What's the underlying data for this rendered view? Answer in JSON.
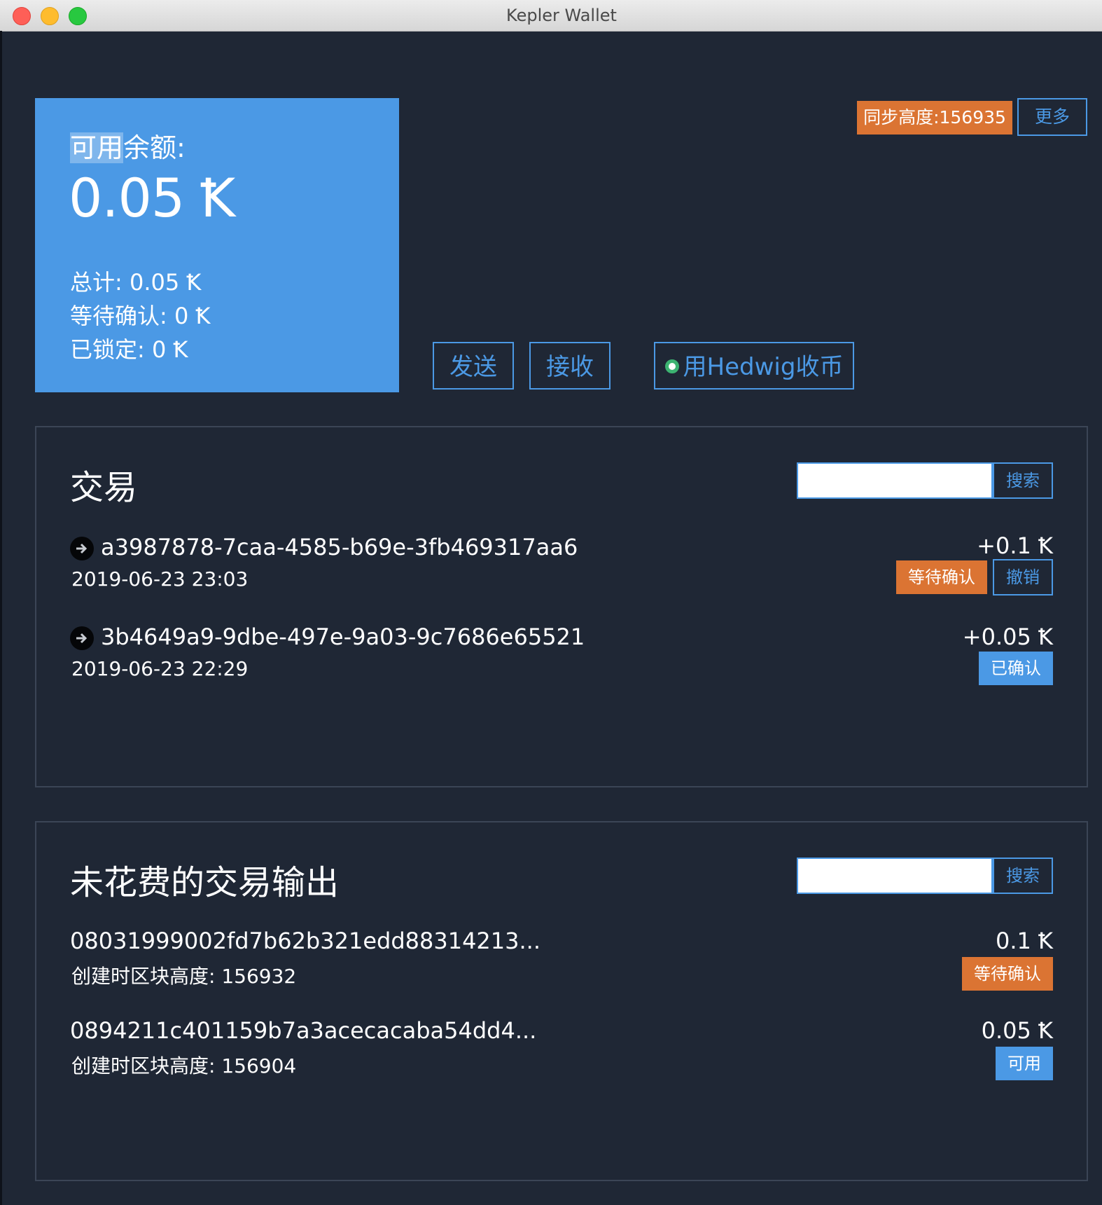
{
  "window": {
    "title": "Kepler Wallet"
  },
  "balance": {
    "label_highlight": "可用",
    "label_rest": "余额:",
    "amount": "0.05 Ꝁ",
    "total": "总计: 0.05 Ꝁ",
    "pending": "等待确认: 0 Ꝁ",
    "locked": "已锁定: 0 Ꝁ"
  },
  "sync": {
    "label": "同步高度:156935"
  },
  "more_label": "更多",
  "actions": {
    "send": "发送",
    "receive": "接收",
    "hedwig": "用Hedwig收币"
  },
  "transactions": {
    "title": "交易",
    "search_label": "搜索",
    "search_value": "",
    "items": [
      {
        "id": "a3987878-7caa-4585-b69e-3fb469317aa6",
        "time": "2019-06-23 23:03",
        "amount": "+0.1 Ꝁ",
        "status": "等待确认",
        "cancel": "撤销"
      },
      {
        "id": "3b4649a9-9dbe-497e-9a03-9c7686e65521",
        "time": "2019-06-23 22:29",
        "amount": "+0.05 Ꝁ",
        "status": "已确认"
      }
    ]
  },
  "utxo": {
    "title": "未花费的交易输出",
    "search_label": "搜索",
    "search_value": "",
    "items": [
      {
        "commit": "08031999002fd7b62b321edd88314213...",
        "height": "创建时区块高度: 156932",
        "amount": "0.1 Ꝁ",
        "status": "等待确认"
      },
      {
        "commit": "0894211c401159b7a3acecacaba54dd4...",
        "height": "创建时区块高度: 156904",
        "amount": "0.05 Ꝁ",
        "status": "可用"
      }
    ]
  },
  "colors": {
    "accent": "#4b99e5",
    "warning": "#db7433",
    "background": "#1f2735"
  }
}
